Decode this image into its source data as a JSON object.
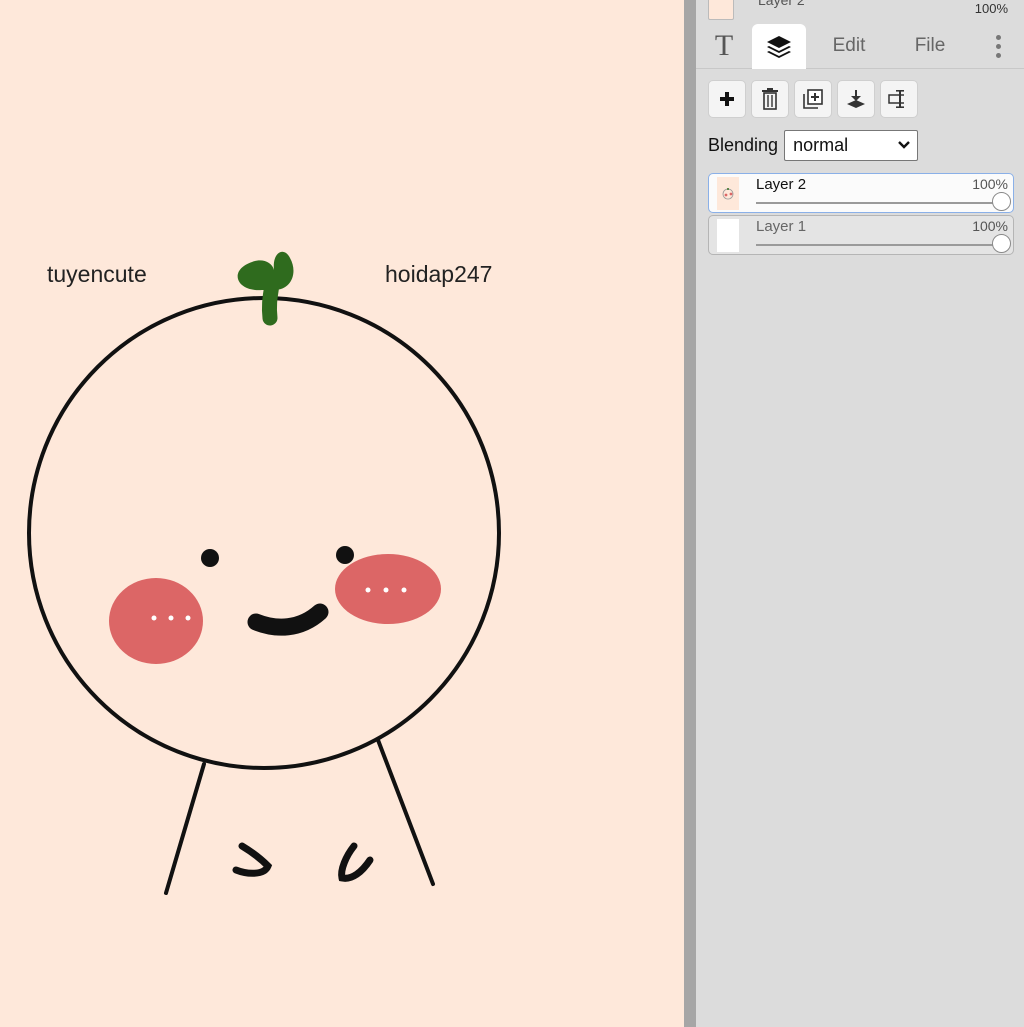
{
  "canvas": {
    "background": "#fee8da",
    "text_left": "tuyencute",
    "text_right": "hoidap247",
    "colors": {
      "cheeks": "#dc6666",
      "sprout": "#2f6b1e",
      "outline": "#111111"
    }
  },
  "panel": {
    "top_layer": {
      "name": "Layer 2",
      "opacity": "100%"
    },
    "tabs": [
      {
        "label": "T",
        "icon": "text-tool-icon"
      },
      {
        "label": "",
        "icon": "layers-icon",
        "active": true
      },
      {
        "label": "Edit"
      },
      {
        "label": "File"
      },
      {
        "label": "",
        "icon": "more-vertical-icon"
      }
    ],
    "toolbar": [
      {
        "icon": "add-layer-icon"
      },
      {
        "icon": "delete-layer-icon"
      },
      {
        "icon": "duplicate-layer-icon"
      },
      {
        "icon": "merge-down-icon"
      },
      {
        "icon": "rename-layer-icon"
      }
    ],
    "blending": {
      "label": "Blending",
      "value": "normal"
    },
    "layers": [
      {
        "name": "Layer 2",
        "opacity": "100%",
        "opacity_value": 1.0,
        "selected": true
      },
      {
        "name": "Layer 1",
        "opacity": "100%",
        "opacity_value": 1.0,
        "selected": false
      }
    ]
  }
}
